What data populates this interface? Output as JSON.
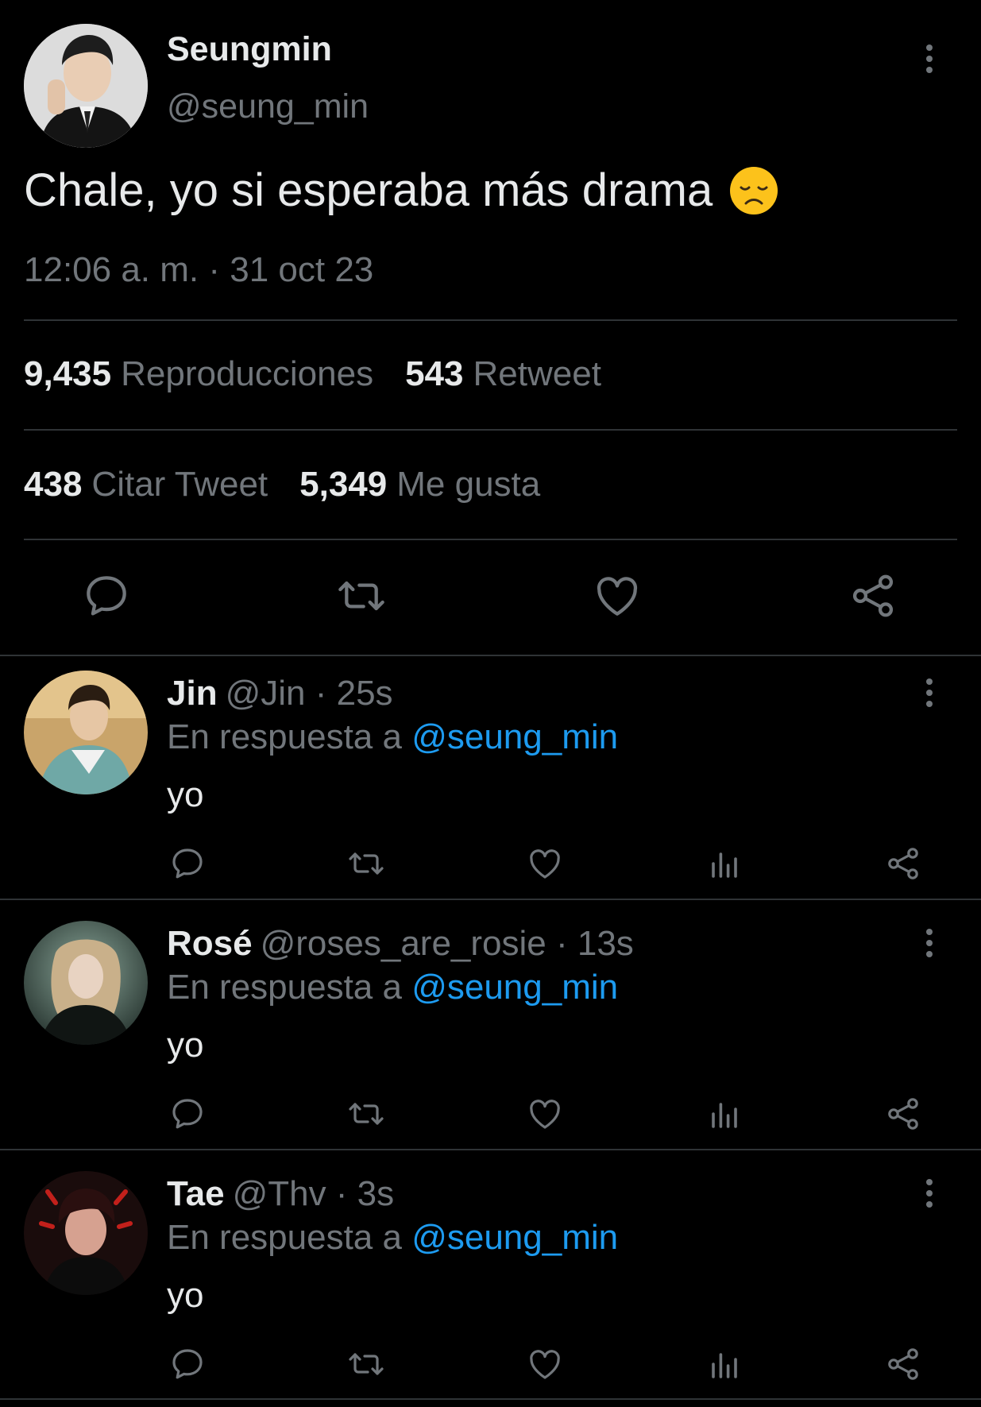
{
  "main_tweet": {
    "name": "Seungmin",
    "handle": "@seung_min",
    "text": "Chale, yo si esperaba más drama",
    "emoji_icon": "disappointed-face-emoji",
    "timestamp": "12:06 a. m. · 31 oct 23",
    "stats": {
      "views_count": "9,435",
      "views_label": "Reproducciones",
      "retweets_count": "543",
      "retweets_label": "Retweet",
      "quotes_count": "438",
      "quotes_label": "Citar Tweet",
      "likes_count": "5,349",
      "likes_label": "Me gusta"
    },
    "actions": [
      "reply-icon",
      "retweet-icon",
      "like-icon",
      "share-icon"
    ]
  },
  "replies": [
    {
      "name": "Jin",
      "handle": "@Jin · 25s",
      "in_reply_prefix": "En respuesta a ",
      "in_reply_to": "@seung_min",
      "text": "yo"
    },
    {
      "name": "Rosé",
      "handle": "@roses_are_rosie · 13s",
      "in_reply_prefix": "En respuesta a ",
      "in_reply_to": "@seung_min",
      "text": "yo"
    },
    {
      "name": "Tae",
      "handle": "@Thv · 3s",
      "in_reply_prefix": "En respuesta a ",
      "in_reply_to": "@seung_min",
      "text": "yo"
    }
  ],
  "colors": {
    "background": "#000000",
    "text": "#e7e9ea",
    "muted": "#71767b",
    "link": "#1d9bf0",
    "divider": "#2f3336"
  }
}
